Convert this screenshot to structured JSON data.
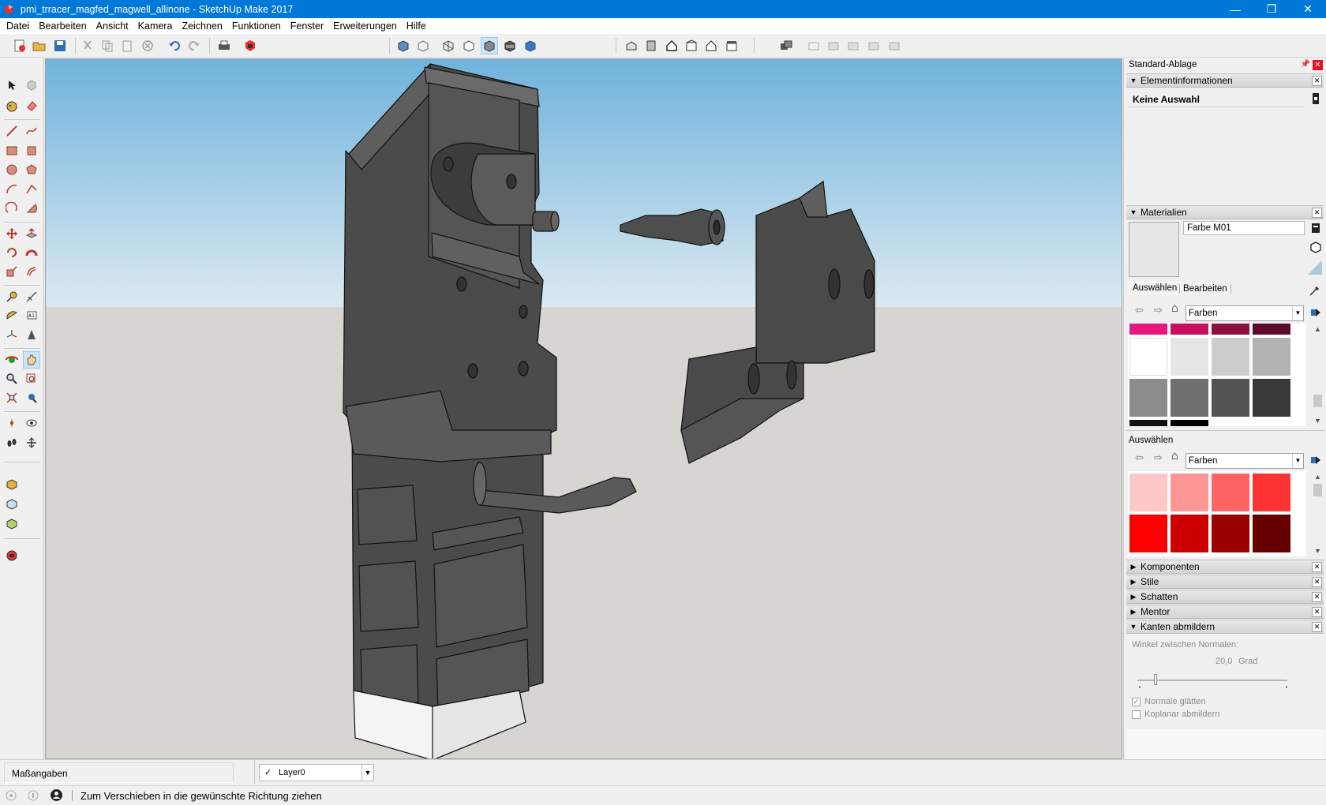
{
  "window": {
    "title": "pmi_trracer_magfed_magwell_allinone - SketchUp Make 2017",
    "minimize": "—",
    "maximize": "❐",
    "close": "✕"
  },
  "menu": [
    "Datei",
    "Bearbeiten",
    "Ansicht",
    "Kamera",
    "Zeichnen",
    "Funktionen",
    "Fenster",
    "Erweiterungen",
    "Hilfe"
  ],
  "tray": {
    "title": "Standard-Ablage",
    "pin": "📌",
    "close": "✕",
    "entity_info": {
      "header": "Elementinformationen",
      "selection": "Keine Auswahl"
    },
    "materials": {
      "header": "Materialien",
      "material_name": "Farbe M01",
      "tabs": [
        "Auswählen",
        "Bearbeiten"
      ],
      "library": "Farben",
      "colors_top_row": [
        "#e8177b",
        "#c8105f",
        "#8d0f3f",
        "#5e0a2b"
      ],
      "colors_row2": [
        "#ffffff",
        "#e6e6e6",
        "#cccccc",
        "#b2b2b2"
      ],
      "colors_row3": [
        "#8c8c8c",
        "#707070",
        "#545454",
        "#383838"
      ],
      "secondary_label": "Auswählen",
      "secondary_library": "Farben",
      "secondary_row1": [
        "#ffc8c8",
        "#ff9696",
        "#ff6464",
        "#ff3232"
      ],
      "secondary_row2": [
        "#ff0000",
        "#cc0000",
        "#990000",
        "#660000"
      ]
    },
    "collapsed_panels": [
      "Komponenten",
      "Stile",
      "Schatten",
      "Mentor"
    ],
    "soften_edges": {
      "header": "Kanten abmildern",
      "angle_label": "Winkel zwischen Normalen:",
      "angle_value": "20,0",
      "angle_unit": "Grad",
      "angle_fraction": 0.12,
      "smooth_normals": "Normale glätten",
      "smooth_normals_checked": true,
      "soften_coplanar": "Koplanar abmildern",
      "soften_coplanar_checked": false
    }
  },
  "statusbar": {
    "measurements_label": "Maßangaben",
    "layer_value": "Layer0",
    "hint": "Zum Verschieben in die gewünschte Richtung ziehen",
    "layer_check": "✓"
  },
  "colors": {
    "sky_top": "#6fb3dc",
    "sky_bottom": "#dbe9f1",
    "ground": "#d7d5d2",
    "part_dark": "#4a4a4a",
    "part_mid": "#5a5a5a",
    "part_light": "#6b6b6b",
    "titlebar": "#0078d7"
  }
}
